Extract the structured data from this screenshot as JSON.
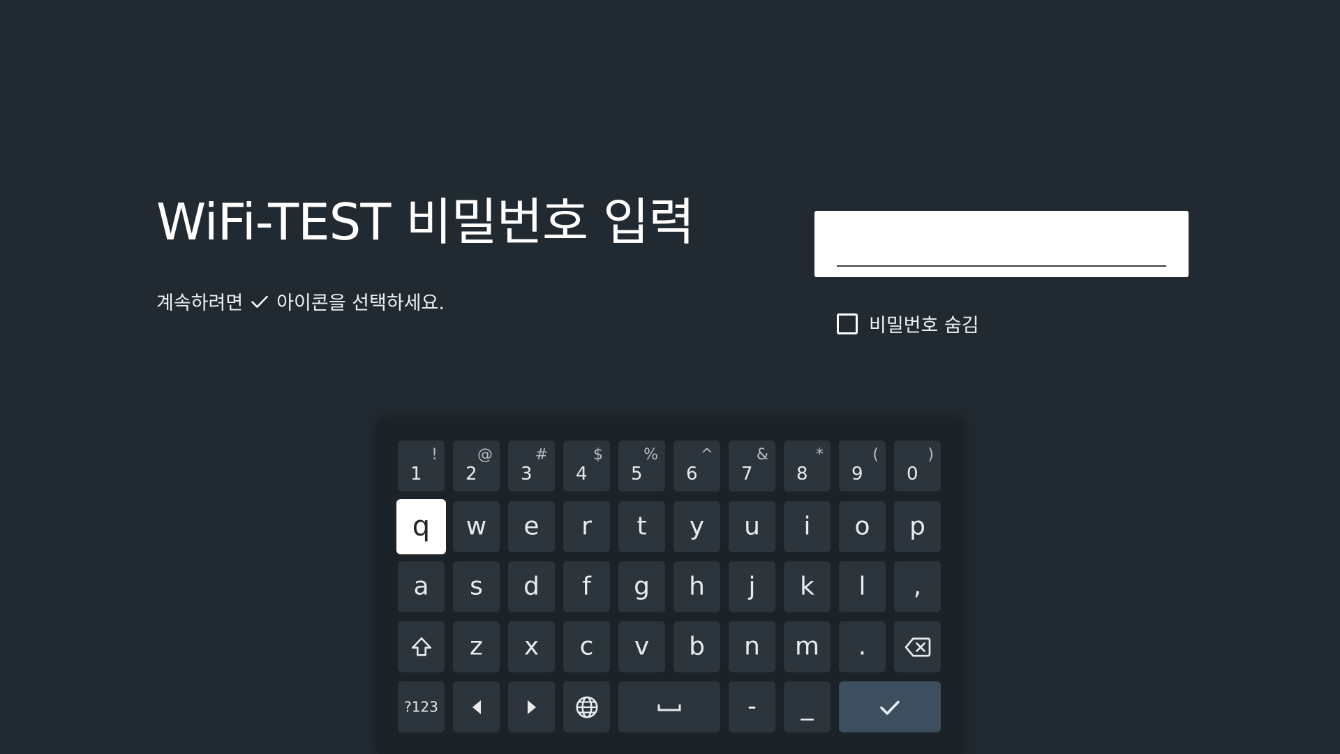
{
  "heading": {
    "title": "WiFi-TEST 비밀번호 입력",
    "instruction_before": "계속하려면",
    "instruction_after": "아이콘을 선택하세요."
  },
  "password": {
    "value": "",
    "hide_label": "비밀번호 숨김",
    "hide_checked": false
  },
  "keyboard": {
    "number_row": [
      {
        "main": "1",
        "sub": "!"
      },
      {
        "main": "2",
        "sub": "@"
      },
      {
        "main": "3",
        "sub": "#"
      },
      {
        "main": "4",
        "sub": "$"
      },
      {
        "main": "5",
        "sub": "%"
      },
      {
        "main": "6",
        "sub": "^"
      },
      {
        "main": "7",
        "sub": "&"
      },
      {
        "main": "8",
        "sub": "*"
      },
      {
        "main": "9",
        "sub": "("
      },
      {
        "main": "0",
        "sub": ")"
      }
    ],
    "row_q": [
      "q",
      "w",
      "e",
      "r",
      "t",
      "y",
      "u",
      "i",
      "o",
      "p"
    ],
    "row_a": [
      "a",
      "s",
      "d",
      "f",
      "g",
      "h",
      "j",
      "k",
      "l",
      ","
    ],
    "row_z": [
      "z",
      "x",
      "c",
      "v",
      "b",
      "n",
      "m",
      "."
    ],
    "symbols_label": "?123",
    "dash": "-",
    "underscore": "_",
    "focused_key": "q",
    "icons": {
      "shift": "shift-arrow-icon",
      "backspace": "backspace-icon",
      "left": "arrow-left-icon",
      "right": "arrow-right-icon",
      "language": "globe-icon",
      "space": "space-bar-icon",
      "enter": "check-icon"
    },
    "accent_color": "#3d4f5f"
  }
}
